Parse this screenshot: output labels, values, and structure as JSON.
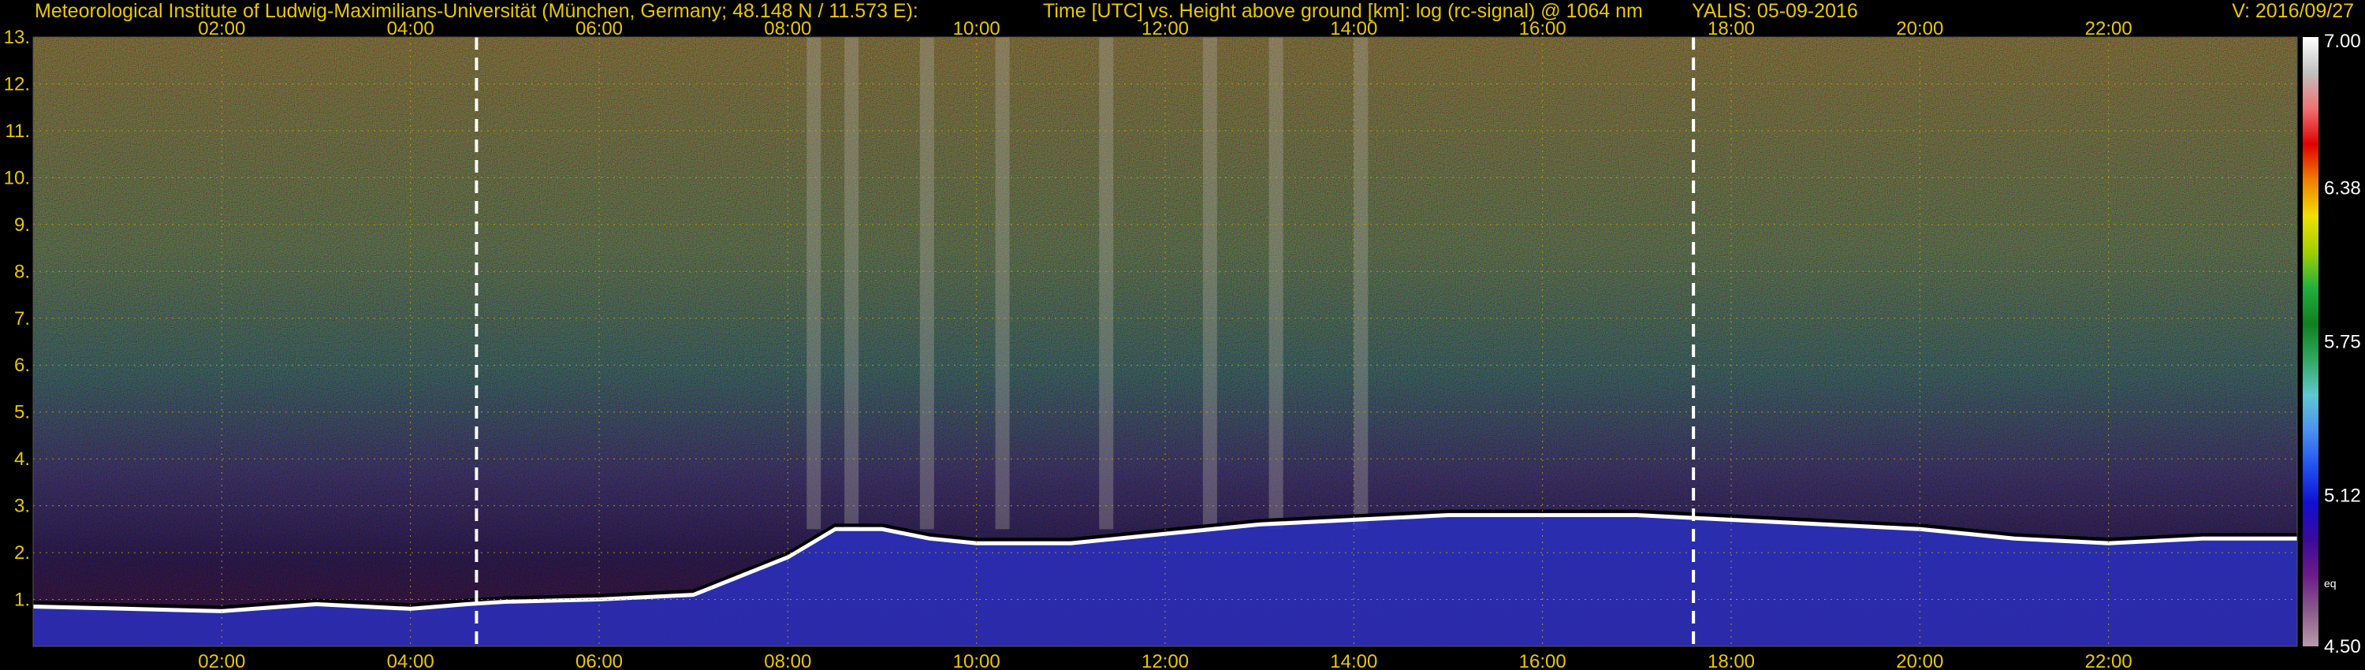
{
  "header": {
    "institute": "Meteorological Institute of Ludwig-Maximilians-Universität (München, Germany; 48.148 N / 11.573 E):",
    "description": "Time [UTC] vs. Height above ground [km]: log (rc-signal) @ 1064 nm",
    "instrument": "YALIS: 05-09-2016",
    "version": "V: 2016/09/27"
  },
  "chart_data": {
    "type": "heatmap",
    "x_unit": "hours UTC",
    "xlim": [
      0,
      24
    ],
    "x_ticks": [
      2,
      4,
      6,
      8,
      10,
      12,
      14,
      16,
      18,
      20,
      22
    ],
    "x_tick_labels": [
      "02:00",
      "04:00",
      "06:00",
      "08:00",
      "10:00",
      "12:00",
      "14:00",
      "16:00",
      "18:00",
      "20:00",
      "22:00"
    ],
    "ylim": [
      0,
      13
    ],
    "y_ticks": [
      1,
      2,
      3,
      4,
      5,
      6,
      7,
      8,
      9,
      10,
      11,
      12,
      13
    ],
    "y_tick_labels": [
      "1.",
      "2.",
      "3.",
      "4.",
      "5.",
      "6.",
      "7.",
      "8.",
      "9.",
      "10.",
      "11.",
      "12.",
      "13."
    ],
    "grid": true,
    "vertical_markers_hours": [
      4.7,
      17.6
    ],
    "colorbar": {
      "min": 4.5,
      "max": 7.0,
      "tick_values": [
        7.0,
        6.38,
        5.75,
        5.12,
        4.5
      ],
      "tick_labels": [
        "7.00",
        "6.38",
        "5.75",
        "5.12",
        "4.50"
      ],
      "extra_label": "eq",
      "colors": [
        "#b89aaa",
        "#8a5a8a",
        "#6a1a8a",
        "#3a0a9a",
        "#1010d0",
        "#2050f0",
        "#4a90f0",
        "#60c8d0",
        "#30a860",
        "#108020",
        "#20b040",
        "#a0d000",
        "#f0e000",
        "#f08000",
        "#e00000",
        "#f07070",
        "#c0c0c0",
        "#ffffff"
      ]
    },
    "boundary_layer_top_km": [
      [
        0.0,
        0.85
      ],
      [
        1.0,
        0.8
      ],
      [
        2.0,
        0.75
      ],
      [
        3.0,
        0.9
      ],
      [
        4.0,
        0.8
      ],
      [
        4.6,
        0.9
      ],
      [
        5.0,
        0.95
      ],
      [
        6.0,
        1.0
      ],
      [
        7.0,
        1.1
      ],
      [
        7.5,
        1.5
      ],
      [
        8.0,
        1.9
      ],
      [
        8.5,
        2.5
      ],
      [
        9.0,
        2.5
      ],
      [
        9.5,
        2.3
      ],
      [
        10.0,
        2.2
      ],
      [
        11.0,
        2.2
      ],
      [
        12.0,
        2.4
      ],
      [
        13.0,
        2.6
      ],
      [
        14.0,
        2.7
      ],
      [
        15.0,
        2.8
      ],
      [
        16.0,
        2.8
      ],
      [
        17.0,
        2.8
      ],
      [
        18.0,
        2.7
      ],
      [
        19.0,
        2.6
      ],
      [
        20.0,
        2.5
      ],
      [
        21.0,
        2.3
      ],
      [
        22.0,
        2.2
      ],
      [
        23.0,
        2.3
      ],
      [
        24.0,
        2.3
      ]
    ]
  }
}
